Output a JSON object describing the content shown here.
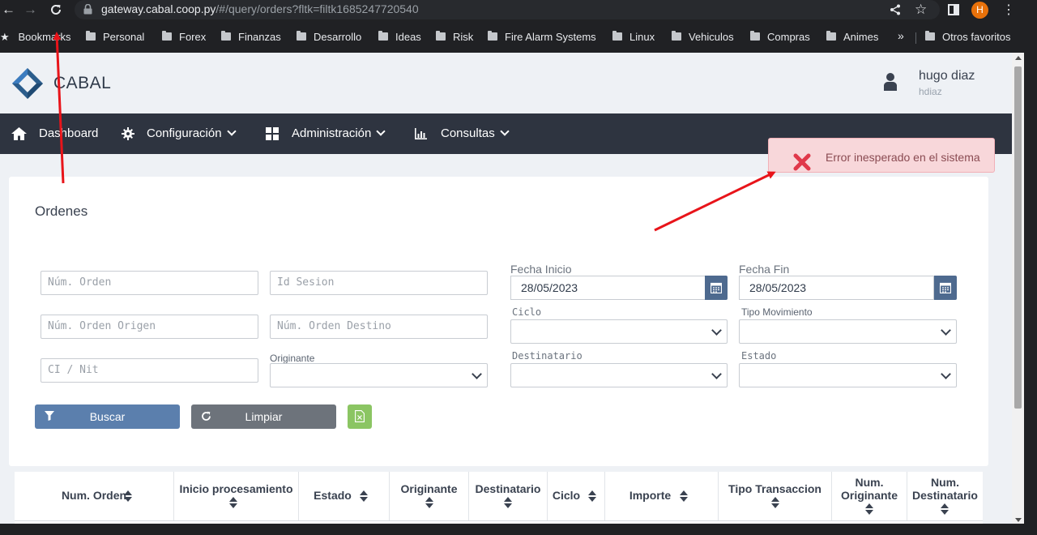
{
  "browser": {
    "url_host": "gateway.cabal.coop.py",
    "url_path": "/#/query/orders?fltk=filtk1685247720540",
    "profile_initial": "H",
    "bookmarks": [
      {
        "label": "Bookmarks"
      },
      {
        "label": "Personal"
      },
      {
        "label": "Forex"
      },
      {
        "label": "Finanzas"
      },
      {
        "label": "Desarrollo"
      },
      {
        "label": "Ideas"
      },
      {
        "label": "Risk"
      },
      {
        "label": "Fire Alarm Systems"
      },
      {
        "label": "Linux"
      },
      {
        "label": "Vehiculos"
      },
      {
        "label": "Compras"
      },
      {
        "label": "Animes"
      }
    ],
    "overflow_label": "»",
    "other_bookmarks": "Otros favoritos"
  },
  "app": {
    "brand": "CABAL",
    "user": {
      "name": "hugo diaz",
      "login": "hdiaz"
    },
    "nav": [
      {
        "label": "Dashboard"
      },
      {
        "label": "Configuración"
      },
      {
        "label": "Administración"
      },
      {
        "label": "Consultas"
      }
    ]
  },
  "form": {
    "title": "Ordenes",
    "num_orden_placeholder": "Núm. Orden",
    "id_sesion_placeholder": "Id Sesion",
    "num_orden_origen_placeholder": "Núm. Orden Origen",
    "num_orden_destino_placeholder": "Núm. Orden Destino",
    "ci_nit_placeholder": "CI / Nit",
    "originante_label": "Originante",
    "fecha_inicio_label": "Fecha Inicio",
    "fecha_inicio_value": "28/05/2023",
    "fecha_fin_label": "Fecha Fin",
    "fecha_fin_value": "28/05/2023",
    "ciclo_label": "Ciclo",
    "tipo_movimiento_label": "Tipo Movimiento",
    "destinatario_label": "Destinatario",
    "estado_label": "Estado",
    "buscar_label": "Buscar",
    "limpiar_label": "Limpiar"
  },
  "table": {
    "columns": [
      {
        "line1": "Num. Orden",
        "line2": ""
      },
      {
        "line1": "Inicio procesamiento",
        "line2": ""
      },
      {
        "line1": "Estado",
        "line2": ""
      },
      {
        "line1": "Originante",
        "line2": ""
      },
      {
        "line1": "Destinatario",
        "line2": ""
      },
      {
        "line1": "Ciclo",
        "line2": ""
      },
      {
        "line1": "Importe",
        "line2": ""
      },
      {
        "line1": "Tipo Transaccion",
        "line2": ""
      },
      {
        "line1": "Num.",
        "line2": "Originante"
      },
      {
        "line1": "Num.",
        "line2": "Destinatario"
      }
    ]
  },
  "toast": {
    "message": "Error inesperado en el sistema",
    "background": "#f8d7da"
  },
  "colors": {
    "navbar": "#2e3440",
    "buscar": "#5b7fad",
    "limpiar": "#6d737b",
    "excel": "#8bc563",
    "annotation_arrow": "#e8141a"
  }
}
